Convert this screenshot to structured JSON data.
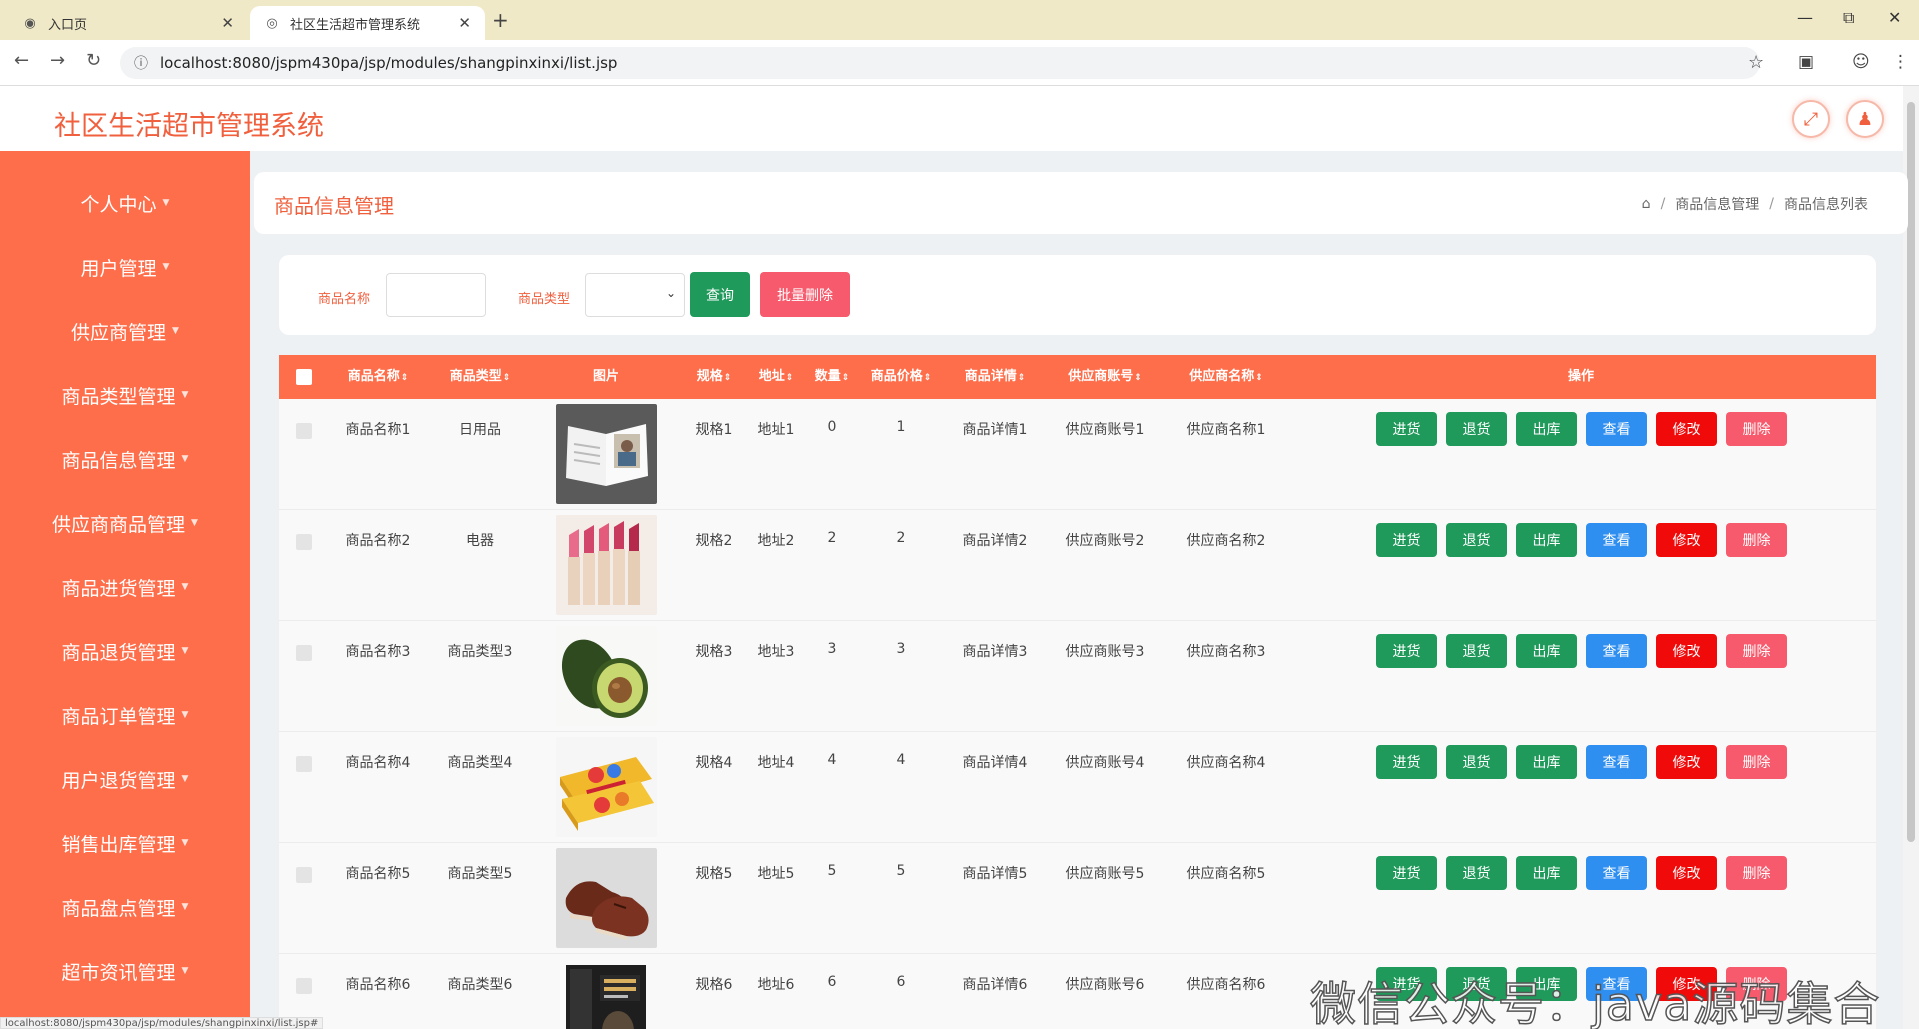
{
  "browser": {
    "tabs": [
      {
        "title": "入口页",
        "active": false
      },
      {
        "title": "社区生活超市管理系统",
        "active": true
      }
    ],
    "url": "localhost:8080/jspm430pa/jsp/modules/shangpinxinxi/list.jsp",
    "status_url": "localhost:8080/jspm430pa/jsp/modules/shangpinxinxi/list.jsp#"
  },
  "header": {
    "title": "社区生活超市管理系统"
  },
  "sidebar": {
    "items": [
      {
        "label": "个人中心"
      },
      {
        "label": "用户管理"
      },
      {
        "label": "供应商管理"
      },
      {
        "label": "商品类型管理"
      },
      {
        "label": "商品信息管理"
      },
      {
        "label": "供应商商品管理"
      },
      {
        "label": "商品进货管理"
      },
      {
        "label": "商品退货管理"
      },
      {
        "label": "商品订单管理"
      },
      {
        "label": "用户退货管理"
      },
      {
        "label": "销售出库管理"
      },
      {
        "label": "商品盘点管理"
      },
      {
        "label": "超市资讯管理"
      }
    ]
  },
  "page": {
    "title": "商品信息管理",
    "breadcrumb": [
      "商品信息管理",
      "商品信息列表"
    ]
  },
  "search": {
    "name_label": "商品名称",
    "name_value": "",
    "type_label": "商品类型",
    "type_value": "",
    "query_button": "查询",
    "batch_delete_button": "批量删除"
  },
  "table": {
    "columns": [
      "商品名称",
      "商品类型",
      "图片",
      "规格",
      "地址",
      "数量",
      "商品价格",
      "商品详情",
      "供应商账号",
      "供应商名称",
      "操作"
    ],
    "actions": [
      "进货",
      "退货",
      "出库",
      "查看",
      "修改",
      "删除"
    ],
    "rows": [
      {
        "name": "商品名称1",
        "type": "日用品",
        "image": "magazine",
        "spec": "规格1",
        "addr": "地址1",
        "qty": "0",
        "price": "1",
        "detail": "商品详情1",
        "supplier_acct": "供应商账号1",
        "supplier_name": "供应商名称1"
      },
      {
        "name": "商品名称2",
        "type": "电器",
        "image": "lipsticks",
        "spec": "规格2",
        "addr": "地址2",
        "qty": "2",
        "price": "2",
        "detail": "商品详情2",
        "supplier_acct": "供应商账号2",
        "supplier_name": "供应商名称2"
      },
      {
        "name": "商品名称3",
        "type": "商品类型3",
        "image": "avocado",
        "spec": "规格3",
        "addr": "地址3",
        "qty": "3",
        "price": "3",
        "detail": "商品详情3",
        "supplier_acct": "供应商账号3",
        "supplier_name": "供应商名称3"
      },
      {
        "name": "商品名称4",
        "type": "商品类型4",
        "image": "snack-boxes",
        "spec": "规格4",
        "addr": "地址4",
        "qty": "4",
        "price": "4",
        "detail": "商品详情4",
        "supplier_acct": "供应商账号4",
        "supplier_name": "供应商名称4"
      },
      {
        "name": "商品名称5",
        "type": "商品类型5",
        "image": "leather-shoes",
        "spec": "规格5",
        "addr": "地址5",
        "qty": "5",
        "price": "5",
        "detail": "商品详情5",
        "supplier_acct": "供应商账号5",
        "supplier_name": "供应商名称5"
      },
      {
        "name": "商品名称6",
        "type": "商品类型6",
        "image": "book",
        "spec": "规格6",
        "addr": "地址6",
        "qty": "6",
        "price": "6",
        "detail": "商品详情6",
        "supplier_acct": "供应商账号6",
        "supplier_name": "供应商名称6"
      }
    ]
  },
  "watermark": "微信公众号：java源码集合",
  "colors": {
    "accent": "#ff6e4a",
    "title": "#f0603e",
    "green": "#1f9a5b",
    "blue": "#2f8ff0",
    "red": "#f00a0a",
    "pink": "#f65a6c"
  }
}
